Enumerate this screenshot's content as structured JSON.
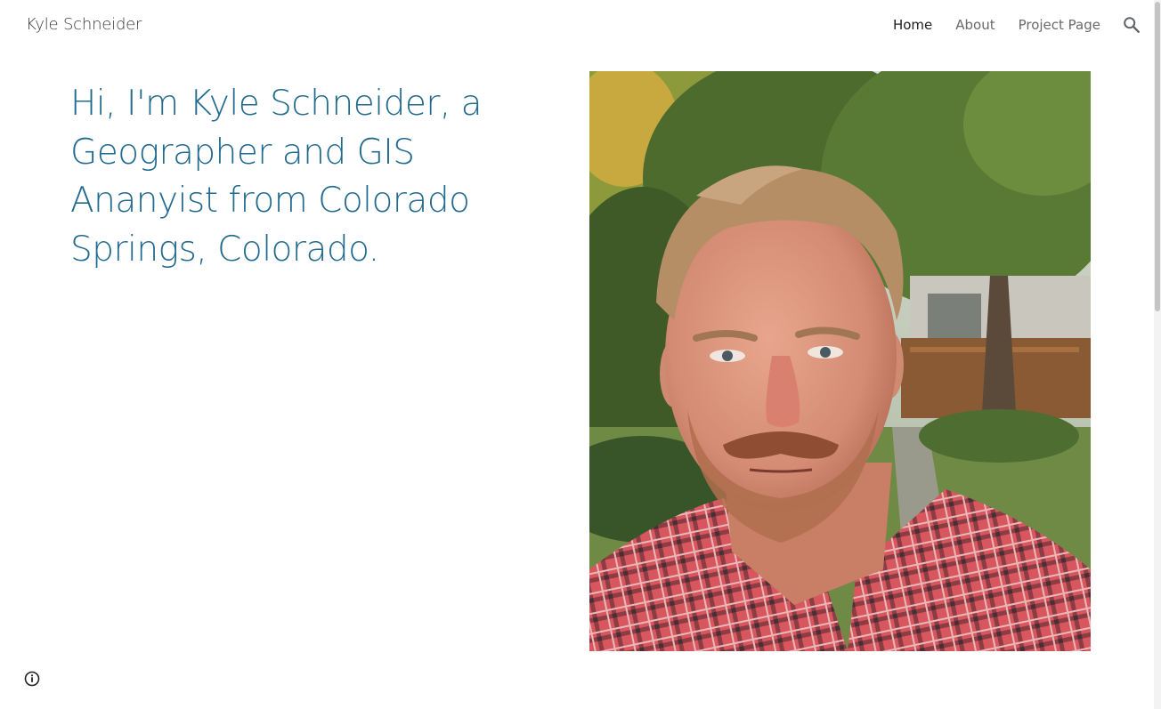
{
  "header": {
    "site_title": "Kyle Schneider",
    "nav": [
      {
        "label": "Home",
        "active": true
      },
      {
        "label": "About",
        "active": false
      },
      {
        "label": "Project Page",
        "active": false
      }
    ],
    "search_icon": "search-icon"
  },
  "main": {
    "headline": "Hi, I'm Kyle Schneider, a Geographer and GIS Ananyist from Colorado Springs, Colorado.",
    "photo_icon": "portrait-photo"
  },
  "footer": {
    "info_icon": "info-icon"
  },
  "colors": {
    "headline": "#236b8e",
    "nav_active": "#202020",
    "nav_inactive": "#6a6a6a"
  }
}
